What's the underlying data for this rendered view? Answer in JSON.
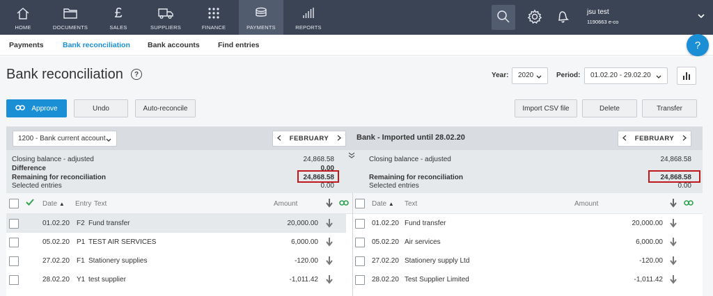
{
  "nav": {
    "items": [
      {
        "label": "HOME",
        "icon": "home-icon"
      },
      {
        "label": "DOCUMENTS",
        "icon": "folder-icon"
      },
      {
        "label": "SALES",
        "icon": "pound-icon"
      },
      {
        "label": "SUPPLIERS",
        "icon": "truck-icon"
      },
      {
        "label": "FINANCE",
        "icon": "grid-icon"
      },
      {
        "label": "PAYMENTS",
        "icon": "coins-icon",
        "active": true
      },
      {
        "label": "REPORTS",
        "icon": "bars-icon"
      }
    ],
    "user_name": "jsu test",
    "user_company": "1190663 e-co"
  },
  "subnav": {
    "payments": "Payments",
    "bank_reconciliation": "Bank reconciliation",
    "bank_accounts": "Bank accounts",
    "find_entries": "Find entries"
  },
  "help_label": "?",
  "header": {
    "title": "Bank reconciliation",
    "year_label": "Year:",
    "year_value": "2020",
    "period_label": "Period:",
    "period_value": "01.02.20 - 29.02.20"
  },
  "toolbar": {
    "approve": "Approve",
    "undo": "Undo",
    "auto_reconcile": "Auto-reconcile",
    "import_csv": "Import CSV file",
    "delete": "Delete",
    "transfer": "Transfer"
  },
  "left": {
    "account": "1200 - Bank current account",
    "month": "FEBRUARY",
    "summary": {
      "closing_label": "Closing balance - adjusted",
      "closing_value": "24,868.58",
      "difference_label": "Difference",
      "difference_value": "0.00",
      "remaining_label": "Remaining for reconciliation",
      "remaining_value": "24,868.58",
      "selected_label": "Selected entries",
      "selected_value": "0.00"
    },
    "columns": {
      "date": "Date",
      "entry": "Entry",
      "text": "Text",
      "amount": "Amount"
    },
    "rows": [
      {
        "date": "01.02.20",
        "entry": "F2",
        "text": "Fund transfer",
        "amount": "20,000.00"
      },
      {
        "date": "05.02.20",
        "entry": "P1",
        "text": "TEST AIR SERVICES",
        "amount": "6,000.00"
      },
      {
        "date": "27.02.20",
        "entry": "F1",
        "text": "Stationery supplies",
        "amount": "-120.00"
      },
      {
        "date": "28.02.20",
        "entry": "Y1",
        "text": "test supplier",
        "amount": "-1,011.42"
      }
    ]
  },
  "right": {
    "title": "Bank - Imported until 28.02.20",
    "month": "FEBRUARY",
    "summary": {
      "closing_label": "Closing balance - adjusted",
      "closing_value": "24,868.58",
      "remaining_label": "Remaining for reconciliation",
      "remaining_value": "24,868.58",
      "selected_label": "Selected entries",
      "selected_value": "0.00"
    },
    "columns": {
      "date": "Date",
      "text": "Text",
      "amount": "Amount"
    },
    "rows": [
      {
        "date": "01.02.20",
        "text": "Fund transfer",
        "amount": "20,000.00"
      },
      {
        "date": "05.02.20",
        "text": "Air services",
        "amount": "6,000.00"
      },
      {
        "date": "27.02.20",
        "text": "Stationery supply Ltd",
        "amount": "-120.00"
      },
      {
        "date": "28.02.20",
        "text": "Test Supplier Limited",
        "amount": "-1,011.42"
      }
    ]
  },
  "colors": {
    "nav_bg": "#3b4455",
    "accent": "#1a8fd6",
    "highlight": "#c0171d",
    "check": "#2ea44f"
  }
}
